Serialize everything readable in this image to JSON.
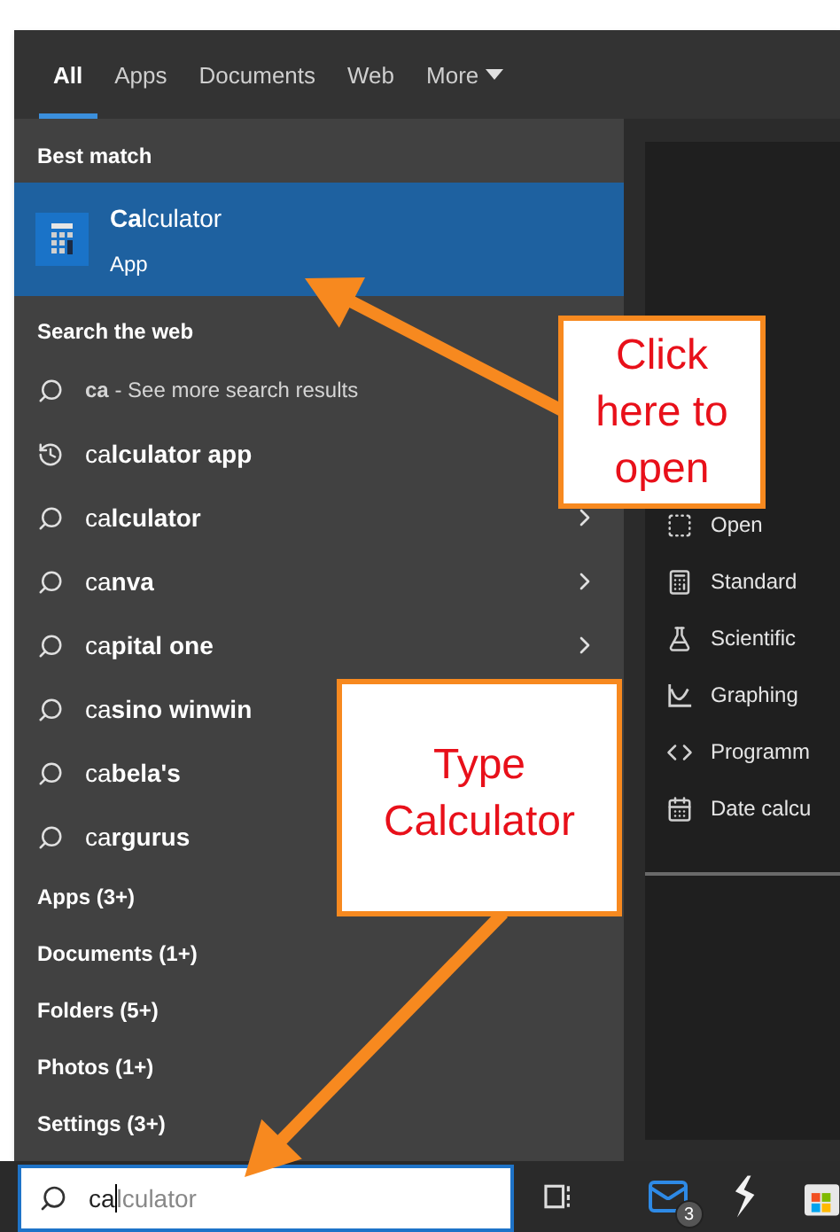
{
  "tabs": [
    {
      "label": "All",
      "selected": true
    },
    {
      "label": "Apps",
      "selected": false
    },
    {
      "label": "Documents",
      "selected": false
    },
    {
      "label": "Web",
      "selected": false
    },
    {
      "label": "More",
      "selected": false
    }
  ],
  "best_match": {
    "heading": "Best match",
    "title": "**Ca**lculator",
    "subtitle": "App",
    "selected": true
  },
  "web": {
    "heading": "Search the web",
    "items": [
      {
        "kind": "search",
        "text": "**ca** - See more search results"
      },
      {
        "kind": "history",
        "text": "ca**lculator app**"
      },
      {
        "kind": "search",
        "text": "ca**lculator**",
        "chevron": true
      },
      {
        "kind": "search",
        "text": "ca**nva**",
        "chevron": true
      },
      {
        "kind": "search",
        "text": "ca**pital one**",
        "chevron": true
      },
      {
        "kind": "search",
        "text": "ca**sino winwin**"
      },
      {
        "kind": "search",
        "text": "ca**bela's**"
      },
      {
        "kind": "search",
        "text": "ca**rgurus**"
      }
    ]
  },
  "categories": [
    "Apps (3+)",
    "Documents (1+)",
    "Folders (5+)",
    "Photos (1+)",
    "Settings (3+)"
  ],
  "actions": [
    {
      "kind": "open",
      "label": "Open"
    },
    {
      "kind": "standard",
      "label": "Standard"
    },
    {
      "kind": "scientific",
      "label": "Scientific"
    },
    {
      "kind": "graphing",
      "label": "Graphing"
    },
    {
      "kind": "programmer",
      "label": "Programm"
    },
    {
      "kind": "date",
      "label": "Date calcu"
    }
  ],
  "search_box": {
    "value": "ca",
    "suggestion": "lculator"
  },
  "taskbar": {
    "mail_badge": "3"
  },
  "callouts": [
    {
      "text": "Click here to open"
    },
    {
      "text": "Type Calculator"
    }
  ]
}
